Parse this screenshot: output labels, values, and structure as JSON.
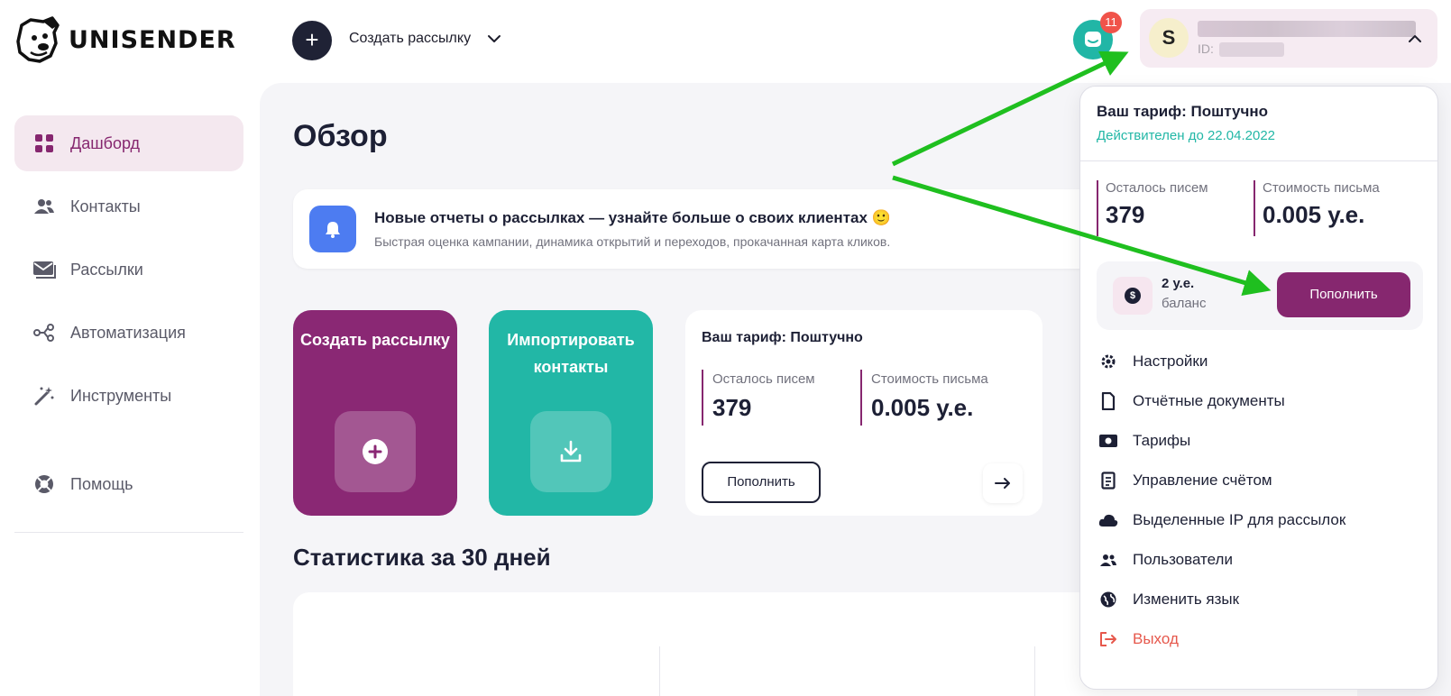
{
  "app": {
    "logo_text": "UNISENDER"
  },
  "header": {
    "create_label": "Создать рассылку",
    "support_badge_count": "11",
    "account_initial": "S",
    "account_id_label": "ID:"
  },
  "sidebar": {
    "items": [
      {
        "label": "Дашборд",
        "icon": "grid-icon",
        "active": true
      },
      {
        "label": "Контакты",
        "icon": "users-icon"
      },
      {
        "label": "Рассылки",
        "icon": "mail-icon"
      },
      {
        "label": "Автоматизация",
        "icon": "share-icon"
      },
      {
        "label": "Инструменты",
        "icon": "magic-wand-icon"
      },
      {
        "label": "Помощь",
        "icon": "lifebuoy-icon"
      }
    ]
  },
  "main": {
    "title": "Обзор",
    "banner": {
      "title": "Новые отчеты о рассылках — узнайте больше о своих клиентах 🙂",
      "subtitle": "Быстрая оценка кампании, динамика открытий и переходов, прокачанная карта кликов."
    },
    "tiles": {
      "create_title": "Создать рассылку",
      "import_title": "Импортировать контакты"
    },
    "tariff_card": {
      "title": "Ваш тариф: Поштучно",
      "remaining_label": "Осталось писем",
      "remaining_value": "379",
      "cost_label": "Стоимость письма",
      "cost_value": "0.005 у.е.",
      "topup_label": "Пополнить"
    },
    "stats_title": "Статистика за 30 дней"
  },
  "dropdown": {
    "tariff_title": "Ваш тариф: Поштучно",
    "valid_until": "Действителен до 22.04.2022",
    "remaining_label": "Осталось писем",
    "remaining_value": "379",
    "cost_label": "Стоимость письма",
    "cost_value": "0.005 у.е.",
    "balance_amount": "2 у.е.",
    "balance_label": "баланс",
    "topup_label": "Пополнить",
    "menu": [
      {
        "label": "Настройки",
        "icon": "gear-icon"
      },
      {
        "label": "Отчётные документы",
        "icon": "document-icon"
      },
      {
        "label": "Тарифы",
        "icon": "banknote-icon"
      },
      {
        "label": "Управление счётом",
        "icon": "invoice-icon"
      },
      {
        "label": "Выделенные IP для рассылок",
        "icon": "cloud-icon"
      },
      {
        "label": "Пользователи",
        "icon": "users-icon"
      },
      {
        "label": "Изменить язык",
        "icon": "globe-icon"
      },
      {
        "label": "Выход",
        "icon": "logout-icon"
      }
    ]
  },
  "colors": {
    "brand_purple": "#86276f",
    "teal": "#22b7a6",
    "dark": "#1d2035",
    "badge_red": "#f0534a",
    "annotation_arrow": "#1fbf1f",
    "exit_red": "#e6584c"
  }
}
